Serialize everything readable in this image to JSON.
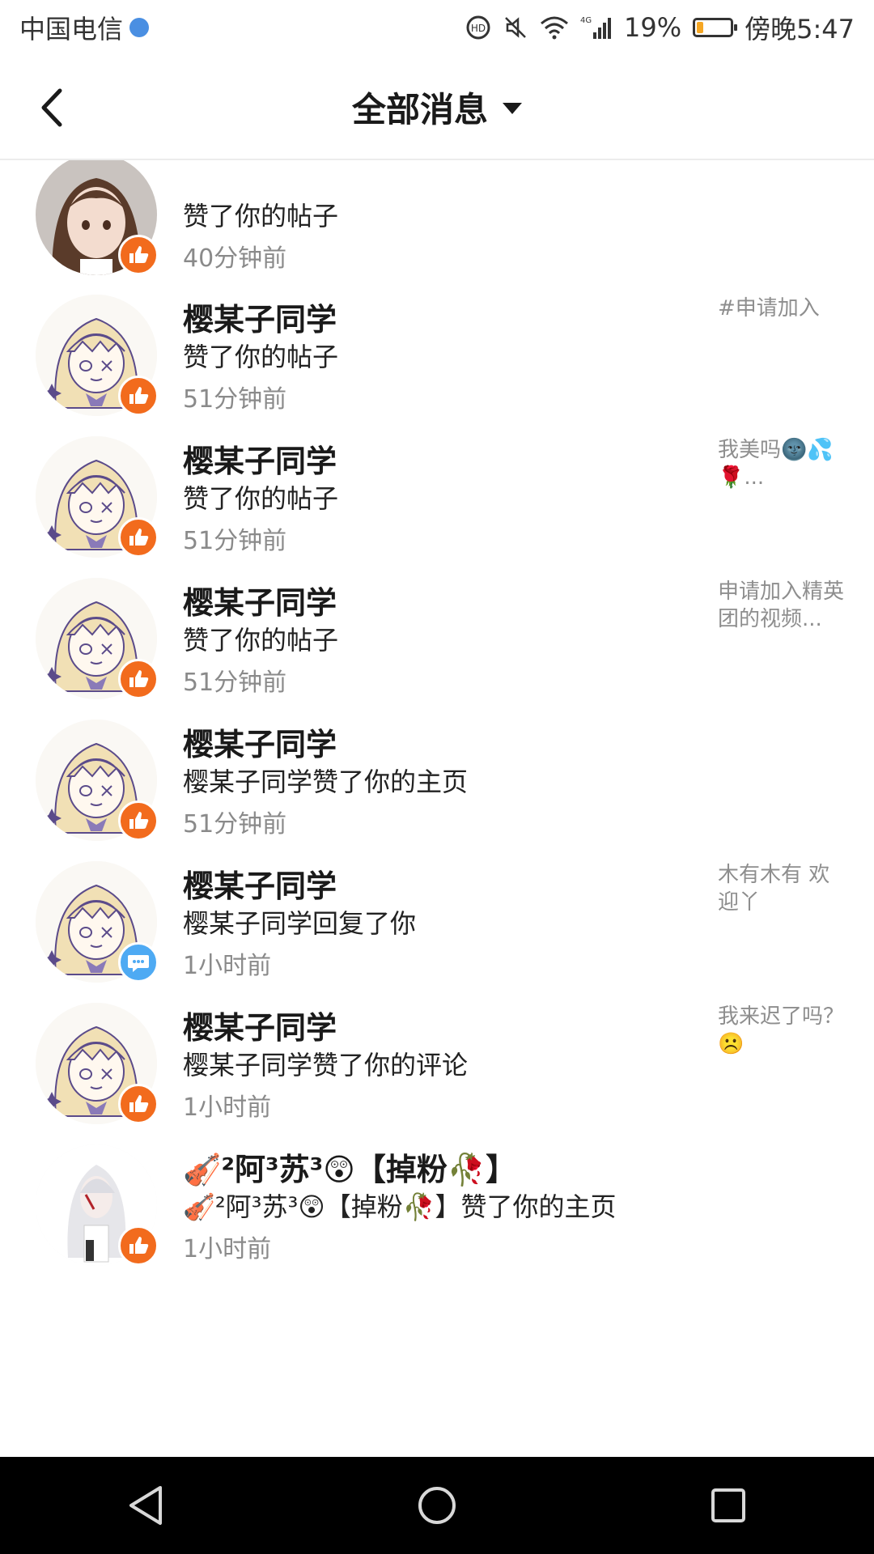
{
  "status_bar": {
    "carrier": "中国电信",
    "network": "4G",
    "battery_percent": "19%",
    "battery_level": 0.19,
    "time": "傍晚5:47"
  },
  "header": {
    "title": "全部消息"
  },
  "messages": [
    {
      "name": "",
      "action": "赞了你的帖子",
      "time": "40分钟前",
      "preview": "",
      "badge": "like",
      "avatar": "brown-hair-girl"
    },
    {
      "name": "樱某子同学",
      "action": "赞了你的帖子",
      "time": "51分钟前",
      "preview": "#申请加入",
      "badge": "like",
      "avatar": "blonde-anime-girl"
    },
    {
      "name": "樱某子同学",
      "action": "赞了你的帖子",
      "time": "51分钟前",
      "preview": "我美吗🌚💦🌹...",
      "badge": "like",
      "avatar": "blonde-anime-girl"
    },
    {
      "name": "樱某子同学",
      "action": "赞了你的帖子",
      "time": "51分钟前",
      "preview": "申请加入精英团的视频...",
      "badge": "like",
      "avatar": "blonde-anime-girl"
    },
    {
      "name": "樱某子同学",
      "action": "樱某子同学赞了你的主页",
      "time": "51分钟前",
      "preview": "",
      "badge": "like",
      "avatar": "blonde-anime-girl"
    },
    {
      "name": "樱某子同学",
      "action": "樱某子同学回复了你",
      "time": "1小时前",
      "preview": "木有木有 欢迎丫",
      "badge": "comment",
      "avatar": "blonde-anime-girl"
    },
    {
      "name": "樱某子同学",
      "action": "樱某子同学赞了你的评论",
      "time": "1小时前",
      "preview": "我来迟了吗？☹️",
      "badge": "like",
      "avatar": "blonde-anime-girl"
    },
    {
      "name": "🎻²阿³苏³😲【掉粉🥀】",
      "action": "🎻²阿³苏³😲【掉粉🥀】赞了你的主页",
      "time": "1小时前",
      "preview": "",
      "badge": "like",
      "avatar": "white-hair-girl"
    }
  ]
}
